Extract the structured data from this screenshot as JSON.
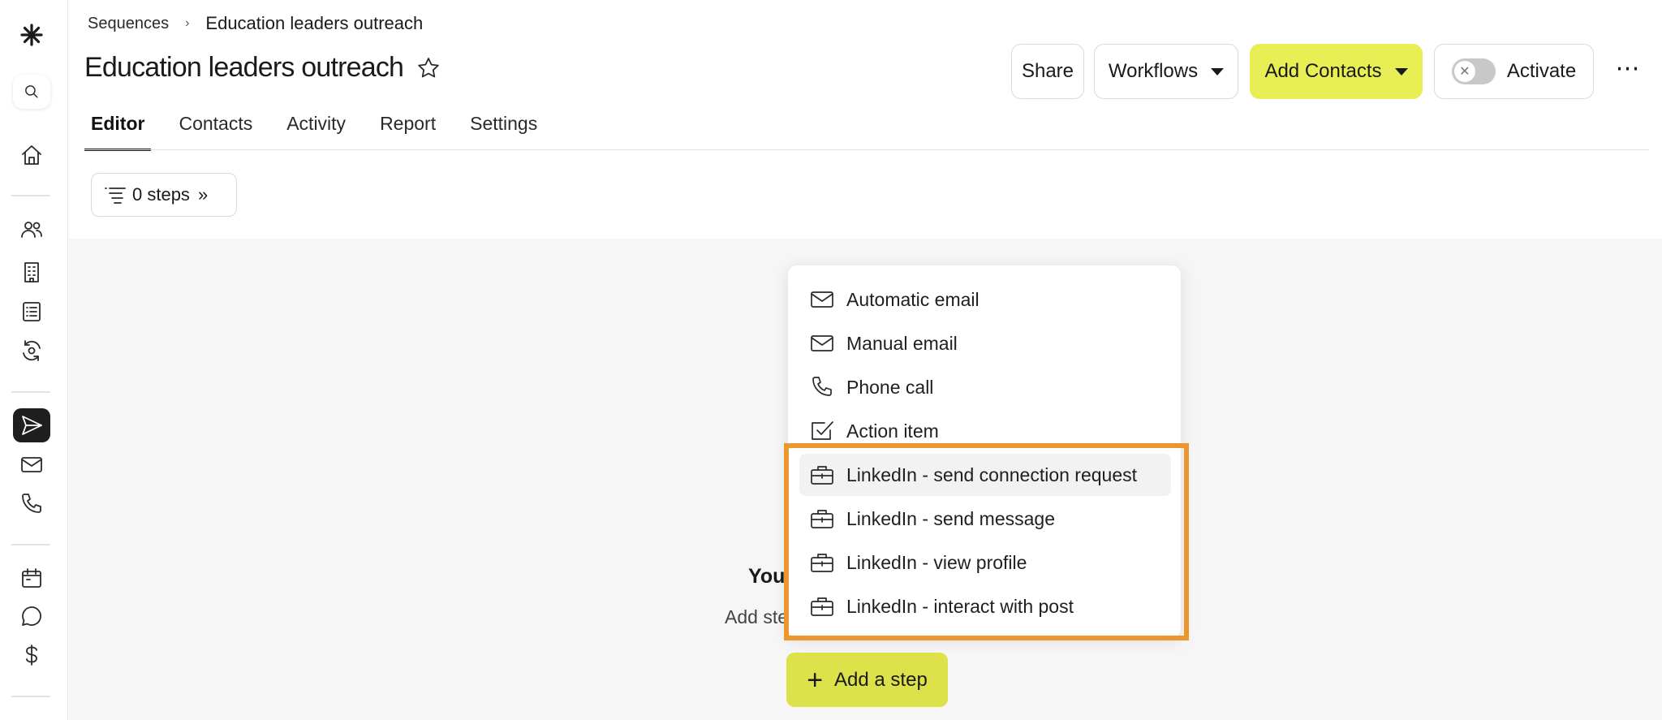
{
  "breadcrumb": {
    "parent": "Sequences",
    "separator": "›",
    "current": "Education leaders outreach"
  },
  "page": {
    "title": "Education leaders outreach"
  },
  "toolbar": {
    "share_label": "Share",
    "workflows_label": "Workflows",
    "add_contacts_label": "Add Contacts",
    "activate_label": "Activate",
    "activate_toggle_on": false,
    "more_label": "⋯"
  },
  "tabs": [
    {
      "label": "Editor",
      "active": true
    },
    {
      "label": "Contacts",
      "active": false
    },
    {
      "label": "Activity",
      "active": false
    },
    {
      "label": "Report",
      "active": false
    },
    {
      "label": "Settings",
      "active": false
    }
  ],
  "steps_button": {
    "label": "0 steps",
    "chevron": "»"
  },
  "empty_state": {
    "title": "You",
    "subtitle": "Add ste"
  },
  "add_step": {
    "label": "Add a step"
  },
  "step_menu": {
    "items": [
      {
        "label": "Automatic email",
        "icon": "mail-icon"
      },
      {
        "label": "Manual email",
        "icon": "mail-icon"
      },
      {
        "label": "Phone call",
        "icon": "phone-icon"
      },
      {
        "label": "Action item",
        "icon": "checkbox-icon"
      },
      {
        "label": "LinkedIn - send connection request",
        "icon": "briefcase-icon"
      },
      {
        "label": "LinkedIn - send message",
        "icon": "briefcase-icon"
      },
      {
        "label": "LinkedIn - view profile",
        "icon": "briefcase-icon"
      },
      {
        "label": "LinkedIn - interact with post",
        "icon": "briefcase-icon"
      }
    ]
  },
  "colors": {
    "accent_yellow": "#e8ef54",
    "add_step_yellow": "#dde24a",
    "highlight_orange": "#ec962e",
    "sidebar_active": "#1f1f1f"
  }
}
